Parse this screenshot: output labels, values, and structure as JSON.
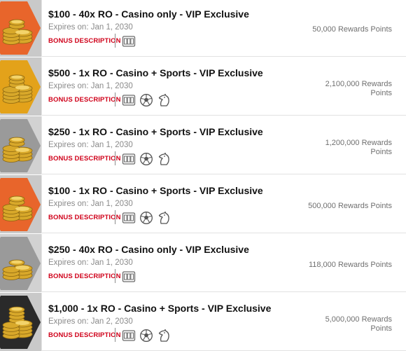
{
  "colors": {
    "title": "#111111",
    "expires": "#8a8a8a",
    "bonus_link": "#d0021b",
    "points": "#6f6f6f",
    "tier_orange": "#e8652b",
    "tier_gold": "#e3a21a",
    "tier_silver": "#9a9a9a",
    "tier_black": "#2a2a2a"
  },
  "offers": [
    {
      "title": "$100 - 40x RO - Casino only - VIP Exclusive",
      "expires": "Expires on: Jan 1, 2030",
      "bonus_label": "BONUS DESCRIPTION",
      "points": "50,000 Rewards Points",
      "tier": "orange",
      "icons": [
        "slot-machine-icon"
      ]
    },
    {
      "title": "$500 - 1x RO - Casino + Sports - VIP Exclusive",
      "expires": "Expires on: Jan 1, 2030",
      "bonus_label": "BONUS DESCRIPTION",
      "points": "2,100,000 Rewards Points",
      "tier": "gold",
      "icons": [
        "slot-machine-icon",
        "soccer-ball-icon",
        "horse-head-icon"
      ]
    },
    {
      "title": "$250 - 1x RO - Casino + Sports - VIP Exclusive",
      "expires": "Expires on: Jan 1, 2030",
      "bonus_label": "BONUS DESCRIPTION",
      "points": "1,200,000 Rewards Points",
      "tier": "silver",
      "icons": [
        "slot-machine-icon",
        "soccer-ball-icon",
        "horse-head-icon"
      ]
    },
    {
      "title": "$100 - 1x RO - Casino + Sports - VIP Exclusive",
      "expires": "Expires on: Jan 1, 2030",
      "bonus_label": "BONUS DESCRIPTION",
      "points": "500,000 Rewards Points",
      "tier": "orange",
      "icons": [
        "slot-machine-icon",
        "soccer-ball-icon",
        "horse-head-icon"
      ]
    },
    {
      "title": "$250 - 40x RO - Casino only - VIP Exclusive",
      "expires": "Expires on: Jan 1, 2030",
      "bonus_label": "BONUS DESCRIPTION",
      "points": "118,000 Rewards Points",
      "tier": "silver",
      "icons": [
        "slot-machine-icon"
      ]
    },
    {
      "title": "$1,000 - 1x RO - Casino + Sports - VIP Exclusive",
      "expires": "Expires on: Jan 2, 2030",
      "bonus_label": "BONUS DESCRIPTION",
      "points": "5,000,000 Rewards Points",
      "tier": "black",
      "icons": [
        "slot-machine-icon",
        "soccer-ball-icon",
        "horse-head-icon"
      ]
    }
  ]
}
